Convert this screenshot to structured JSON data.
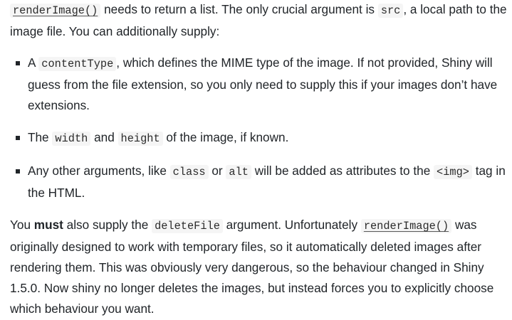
{
  "para1": {
    "code1": "renderImage()",
    "t1": " needs to return a list. The only crucial argument is ",
    "code2": "src",
    "t2": ", a local path to the image file. You can additionally supply:"
  },
  "items": [
    {
      "t1": "A ",
      "code1": "contentType",
      "t2": ", which defines the MIME type of the image. If not provided, Shiny will guess from the file extension, so you only need to supply this if your images don’t have extensions."
    },
    {
      "t1": "The ",
      "code1": "width",
      "t2": " and ",
      "code2": "height",
      "t3": " of the image, if known."
    },
    {
      "t1": "Any other arguments, like ",
      "code1": "class",
      "t2": " or ",
      "code2": "alt",
      "t3": " will be added as attributes to the ",
      "code3": "<img>",
      "t4": " tag in the HTML."
    }
  ],
  "para2": {
    "t1": "You ",
    "bold": "must",
    "t2": " also supply the ",
    "code1": "deleteFile",
    "t3": " argument. Unfortunately ",
    "code2": "renderImage()",
    "t4": " was originally designed to work with temporary files, so it automatically deleted images after rendering them. This was obviously very dangerous, so the behaviour changed in Shiny 1.5.0. Now shiny no longer deletes the images, but instead forces you to explicitly choose which behaviour you want."
  }
}
